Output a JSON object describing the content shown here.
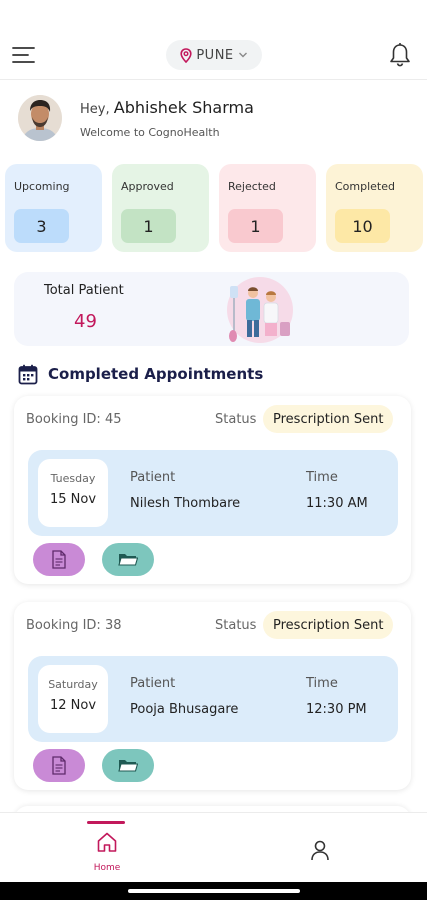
{
  "header": {
    "location": "PUNE",
    "icons": {
      "menu": "hamburger-menu-icon",
      "location": "location-pin-icon",
      "dropdown": "chevron-down-icon",
      "notifications": "bell-icon"
    }
  },
  "greeting": {
    "hey": "Hey,",
    "name": "Abhishek Sharma",
    "welcome": "Welcome to CognoHealth"
  },
  "stats": [
    {
      "label": "Upcoming",
      "value": "3",
      "card_color": "#e3effd",
      "pill_color": "#bcdcfb"
    },
    {
      "label": "Approved",
      "value": "1",
      "card_color": "#e5f4e5",
      "pill_color": "#c3e3c4"
    },
    {
      "label": "Rejected",
      "value": "1",
      "card_color": "#fde8ea",
      "pill_color": "#f9c9cf"
    },
    {
      "label": "Completed",
      "value": "10",
      "card_color": "#fdf3d6",
      "pill_color": "#fde8a6"
    }
  ],
  "total": {
    "label": "Total Patient",
    "value": "49"
  },
  "section": {
    "title": "Completed Appointments",
    "icon": "calendar-icon"
  },
  "appointments": [
    {
      "booking": "Booking ID: 45",
      "status_label": "Status",
      "status": "Prescription Sent",
      "day": "Tuesday",
      "date": "15 Nov",
      "patient_label": "Patient",
      "patient": "Nilesh Thombare",
      "time_label": "Time",
      "time": "11:30 AM"
    },
    {
      "booking": "Booking ID: 38",
      "status_label": "Status",
      "status": "Prescription Sent",
      "day": "Saturday",
      "date": "12 Nov",
      "patient_label": "Patient",
      "patient": "Pooja Bhusagare",
      "time_label": "Time",
      "time": "12:30 PM"
    }
  ],
  "nav": {
    "home": "Home",
    "icons": {
      "home": "home-icon",
      "profile": "user-icon"
    }
  },
  "colors": {
    "accent": "#c2185b",
    "title": "#1b1f4a"
  }
}
